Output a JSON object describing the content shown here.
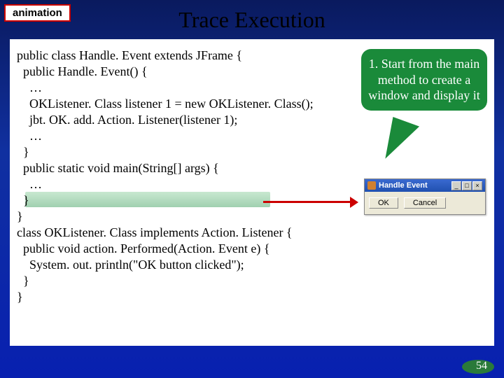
{
  "tag": "animation",
  "title": "Trace Execution",
  "callout": "1. Start from the main method to create a window and display it",
  "code": {
    "l1": "public class Handle. Event extends JFrame {",
    "l2": "  public Handle. Event() {",
    "l3": "    …",
    "l4": "    OKListener. Class listener 1 = new OKListener. Class();",
    "l5": "    jbt. OK. add. Action. Listener(listener 1);",
    "l6": "    …",
    "l7": "  }",
    "l8": "",
    "l9": "  public static void main(String[] args) {",
    "l10": "    …",
    "l11": "  }",
    "l12": "}",
    "l13": "",
    "l14": "class OKListener. Class implements Action. Listener {",
    "l15": "  public void action. Performed(Action. Event e) {",
    "l16": "    System. out. println(\"OK button clicked\");",
    "l17": "  }",
    "l18": "}"
  },
  "mini": {
    "title": "Handle Event",
    "ok": "OK",
    "cancel": "Cancel",
    "min": "_",
    "max": "□",
    "close": "×"
  },
  "page": "54"
}
